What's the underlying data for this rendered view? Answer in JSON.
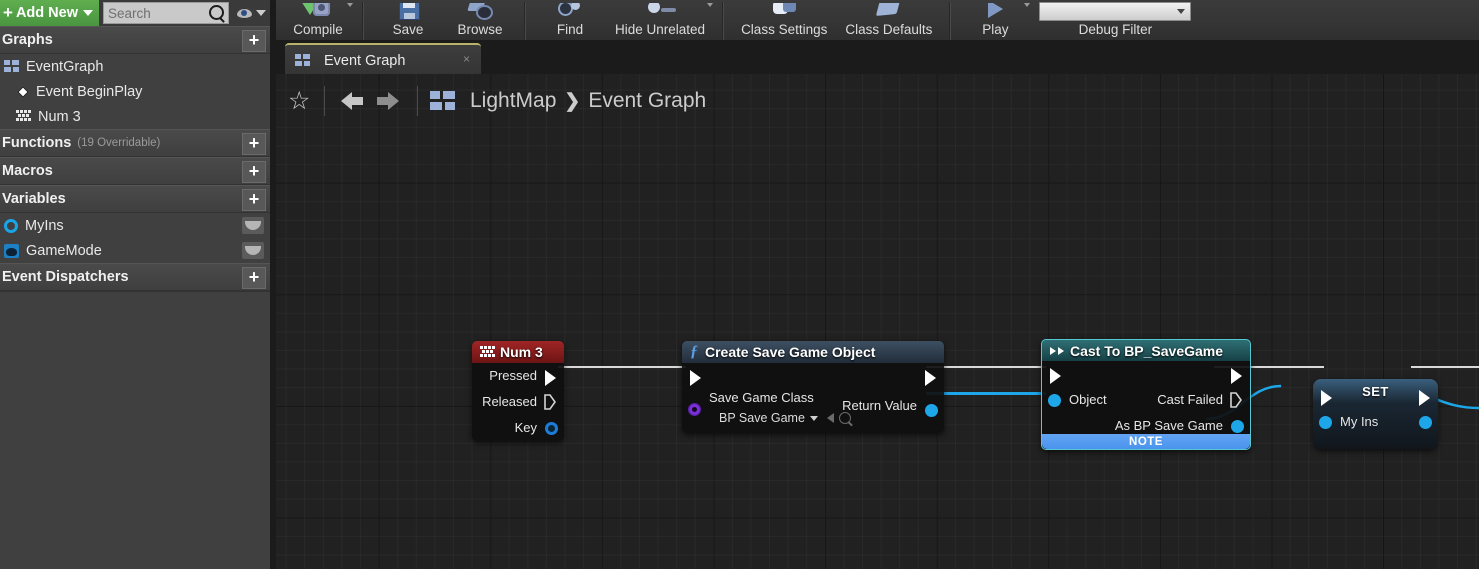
{
  "toolbar": {
    "items": [
      {
        "label": "Compile",
        "icon": "compile-icon",
        "caret": true
      },
      {
        "label": "Save",
        "icon": "save-icon",
        "caret": false
      },
      {
        "label": "Browse",
        "icon": "browse-icon",
        "caret": false
      },
      {
        "label": "Find",
        "icon": "find-icon",
        "caret": false
      },
      {
        "label": "Hide Unrelated",
        "icon": "hide-unrelated-icon",
        "caret": true
      },
      {
        "label": "Class Settings",
        "icon": "class-settings-icon",
        "caret": false
      },
      {
        "label": "Class Defaults",
        "icon": "class-defaults-icon",
        "caret": false
      },
      {
        "label": "Play",
        "icon": "play-icon",
        "caret": true
      },
      {
        "label": "Debug Filter",
        "icon": "debug-filter-combo",
        "caret": false
      }
    ]
  },
  "sidebar": {
    "add_new_label": "Add New",
    "search_placeholder": "Search",
    "sections": [
      {
        "title": "Graphs",
        "sub": ""
      },
      {
        "title": "Functions",
        "sub": "(19 Overridable)"
      },
      {
        "title": "Macros",
        "sub": ""
      },
      {
        "title": "Variables",
        "sub": ""
      },
      {
        "title": "Event Dispatchers",
        "sub": ""
      }
    ],
    "graph_items": [
      {
        "label": "EventGraph",
        "icon": "graph-icon",
        "indent": 0
      },
      {
        "label": "Event BeginPlay",
        "icon": "event-diamond-icon",
        "indent": 1
      },
      {
        "label": "Num 3",
        "icon": "key-input-icon",
        "indent": 1
      }
    ],
    "variables": [
      {
        "label": "MyIns",
        "icon": "object-ref-circle-icon"
      },
      {
        "label": "GameMode",
        "icon": "gamemode-object-icon"
      }
    ],
    "plus_label": "+"
  },
  "graph": {
    "tab_label": "Event Graph",
    "tab_close": "×",
    "breadcrumb": {
      "star": "☆",
      "root": "LightMap",
      "separator": "❯",
      "current": "Event Graph"
    },
    "nodes": [
      {
        "id": "num3",
        "title": "Num 3",
        "type": "input-event",
        "header_color": "#8b1c1c",
        "pins_out_exec": [
          "Pressed",
          "Released"
        ],
        "pins_out_data": [
          {
            "label": "Key",
            "color": "#1c7dd6"
          }
        ]
      },
      {
        "id": "create-save-game-object",
        "title": "Create Save Game Object",
        "type": "function-call",
        "header_color": "#2c3a4a",
        "input_label": "Save Game Class",
        "input_value": "BP Save Game",
        "output_label": "Return Value"
      },
      {
        "id": "cast-to-bp-savegame",
        "title": "Cast To BP_SaveGame",
        "type": "cast",
        "header_color": "#1d4a4e",
        "input_label": "Object",
        "output_fail_label": "Cast Failed",
        "output_label": "As BP Save Game",
        "note_label": "NOTE"
      },
      {
        "id": "set-myins",
        "title": "SET",
        "type": "setter",
        "header_color": "#2a4a63",
        "variable_label": "My Ins"
      }
    ]
  },
  "colors": {
    "exec_wire": "#d9d9d9",
    "data_wire": "#1ea7e8",
    "accent_green": "#5fae4f",
    "tab_highlight": "#b9b26a",
    "note_blue": "#4a93ee"
  }
}
